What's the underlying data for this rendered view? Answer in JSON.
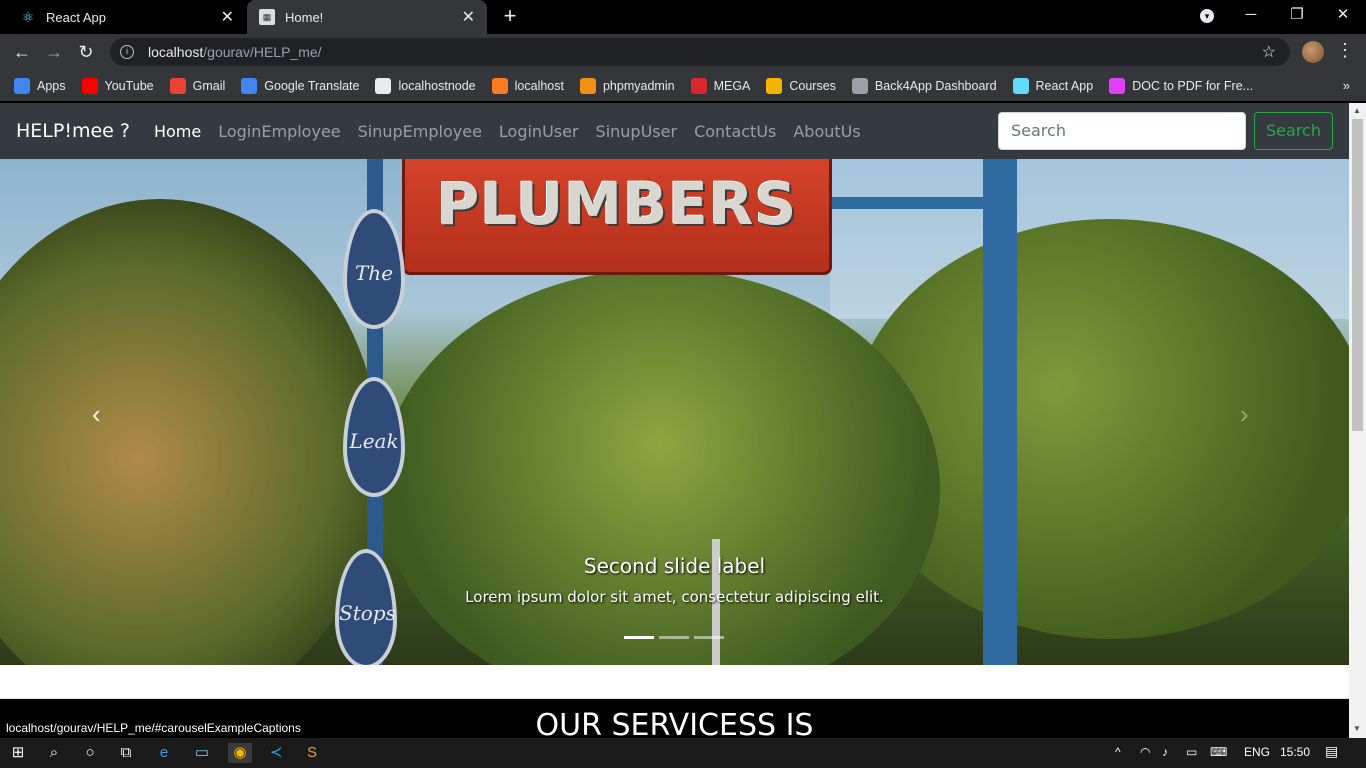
{
  "browser": {
    "tabs": [
      {
        "title": "React App",
        "icon": "react-icon"
      },
      {
        "title": "Home!",
        "icon": "page-icon"
      }
    ],
    "new_tab": "+",
    "window_controls": {
      "minimize": "─",
      "maximize": "❐",
      "close": "✕",
      "profile_menu": "▾"
    },
    "address": {
      "host": "localhost",
      "path": "/gourav/HELP_me/"
    },
    "bookmarks": [
      {
        "label": "Apps",
        "icon": "apps-grid-icon",
        "color": "#4285f4"
      },
      {
        "label": "YouTube",
        "icon": "youtube-icon",
        "color": "#ff0000"
      },
      {
        "label": "Gmail",
        "icon": "gmail-icon",
        "color": "#ea4335"
      },
      {
        "label": "Google Translate",
        "icon": "translate-icon",
        "color": "#4285f4"
      },
      {
        "label": "localhostnode",
        "icon": "globe-icon",
        "color": "#e8eaed"
      },
      {
        "label": "localhost",
        "icon": "xampp-icon",
        "color": "#fb7a24"
      },
      {
        "label": "phpmyadmin",
        "icon": "phpmyadmin-icon",
        "color": "#f29111"
      },
      {
        "label": "MEGA",
        "icon": "mega-icon",
        "color": "#d9272e"
      },
      {
        "label": "Courses",
        "icon": "courses-icon",
        "color": "#f4b400"
      },
      {
        "label": "Back4App Dashboard",
        "icon": "back4app-icon",
        "color": "#9aa0a6"
      },
      {
        "label": "React App",
        "icon": "react-icon",
        "color": "#61dafb"
      },
      {
        "label": "DOC to PDF for Fre...",
        "icon": "doc-to-pdf-icon",
        "color": "#e040fb"
      }
    ],
    "bookmarks_more": "»"
  },
  "navbar": {
    "brand": "HELP!mee ?",
    "links": [
      {
        "label": "Home",
        "active": true
      },
      {
        "label": "LoginEmployee",
        "active": false
      },
      {
        "label": "SinupEmployee",
        "active": false
      },
      {
        "label": "LoginUser",
        "active": false
      },
      {
        "label": "SinupUser",
        "active": false
      },
      {
        "label": "ContactUs",
        "active": false
      },
      {
        "label": "AboutUs",
        "active": false
      }
    ],
    "search_placeholder": "Search",
    "search_button": "Search"
  },
  "carousel": {
    "sign_text": "PLUMBERS",
    "drops": [
      "The",
      "Leak",
      "Stops"
    ],
    "caption_title": "Second slide label",
    "caption_text": "Lorem ipsum dolor sit amet, consectetur adipiscing elit.",
    "active_index": 0,
    "indicator_count": 3,
    "prev": "‹",
    "next": "›"
  },
  "services_heading": "OUR SERVICESS IS",
  "status_url": "localhost/gourav/HELP_me/#carouselExampleCaptions",
  "taskbar": {
    "language": "ENG",
    "time": "15:50"
  }
}
